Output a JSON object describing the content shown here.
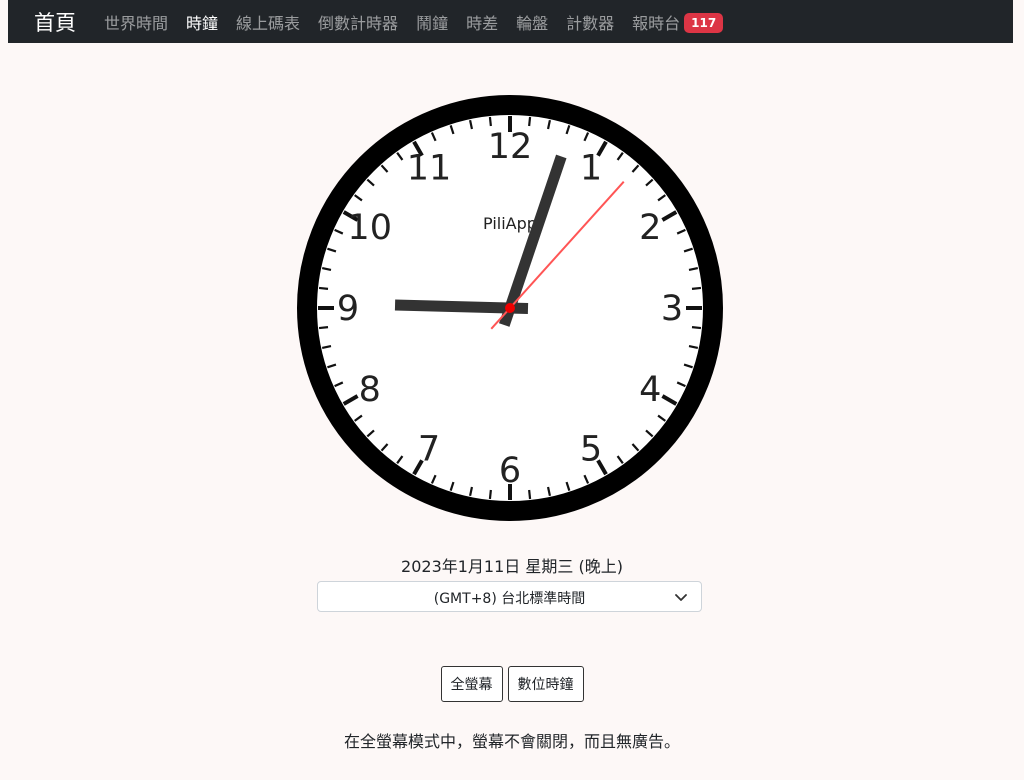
{
  "navbar": {
    "brand": "首頁",
    "items": [
      {
        "label": "世界時間",
        "active": false
      },
      {
        "label": "時鐘",
        "active": true
      },
      {
        "label": "線上碼表",
        "active": false
      },
      {
        "label": "倒數計時器",
        "active": false
      },
      {
        "label": "鬧鐘",
        "active": false
      },
      {
        "label": "時差",
        "active": false
      },
      {
        "label": "輪盤",
        "active": false
      },
      {
        "label": "計數器",
        "active": false
      },
      {
        "label": "報時台",
        "active": false
      }
    ],
    "badge": "117"
  },
  "clock": {
    "logo": "PiliApp",
    "numerals": [
      "12",
      "1",
      "2",
      "3",
      "4",
      "5",
      "6",
      "7",
      "8",
      "9",
      "10",
      "11"
    ],
    "time": {
      "hour": 9,
      "minute": 3,
      "second": 7
    }
  },
  "date_line": "2023年1月11日 星期三 (晚上)",
  "timezone": {
    "selected": "(GMT+8) 台北標準時間"
  },
  "buttons": {
    "fullscreen": "全螢幕",
    "digital": "數位時鐘"
  },
  "note": "在全螢幕模式中，螢幕不會關閉，而且無廣告。",
  "colors": {
    "navbar_bg": "#212529",
    "badge_bg": "#dc3545",
    "second_hand": "#ff5555",
    "center_dot": "#ee0000",
    "hand": "#333333"
  }
}
